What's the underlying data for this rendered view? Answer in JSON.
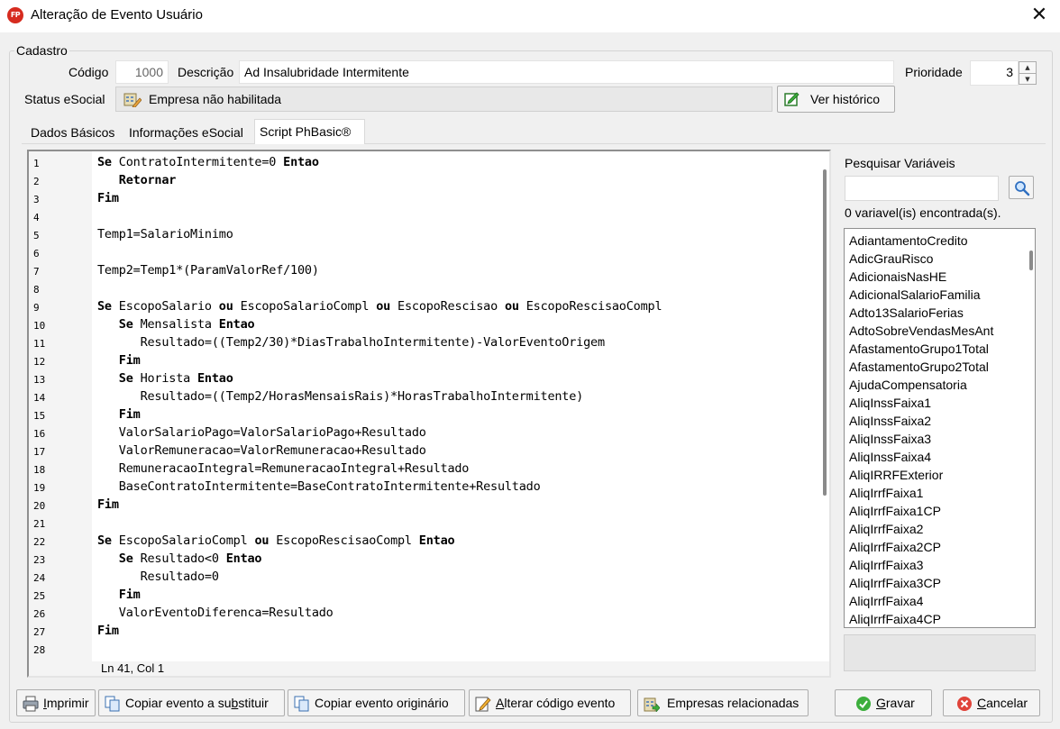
{
  "window": {
    "title": "Alteração de Evento Usuário",
    "logo_text": "FP",
    "close_glyph": "✕"
  },
  "cadastro": {
    "legend": "Cadastro",
    "codigo_label": "Código",
    "codigo_value": "1000",
    "descricao_label": "Descrição",
    "descricao_value": "Ad Insalubridade Intermitente",
    "prioridade_label": "Prioridade",
    "prioridade_value": "3",
    "status_label": "Status eSocial",
    "status_value": "Empresa não habilitada",
    "historico_button": "Ver histórico"
  },
  "tabs": [
    {
      "label": "Dados Básicos"
    },
    {
      "label": "Informações eSocial"
    },
    {
      "label": "Script PhBasic®"
    }
  ],
  "editor": {
    "lines": [
      [
        {
          "t": "Se ",
          "k": 1
        },
        {
          "t": "ContratoIntermitente=0 "
        },
        {
          "t": "Entao",
          "k": 1
        }
      ],
      [
        {
          "t": "   Retornar",
          "k": 1
        }
      ],
      [
        {
          "t": "Fim",
          "k": 1
        }
      ],
      [],
      [
        {
          "t": "Temp1=SalarioMinimo"
        }
      ],
      [],
      [
        {
          "t": "Temp2=Temp1*(ParamValorRef/100)"
        }
      ],
      [],
      [
        {
          "t": "Se ",
          "k": 1
        },
        {
          "t": "EscopoSalario "
        },
        {
          "t": "ou ",
          "k": 1
        },
        {
          "t": "EscopoSalarioCompl "
        },
        {
          "t": "ou ",
          "k": 1
        },
        {
          "t": "EscopoRescisao "
        },
        {
          "t": "ou ",
          "k": 1
        },
        {
          "t": "EscopoRescisaoCompl"
        }
      ],
      [
        {
          "t": "   Se ",
          "k": 1
        },
        {
          "t": "Mensalista "
        },
        {
          "t": "Entao",
          "k": 1
        }
      ],
      [
        {
          "t": "      Resultado=((Temp2/30)*DiasTrabalhoIntermitente)-ValorEventoOrigem"
        }
      ],
      [
        {
          "t": "   Fim",
          "k": 1
        }
      ],
      [
        {
          "t": "   Se ",
          "k": 1
        },
        {
          "t": "Horista "
        },
        {
          "t": "Entao",
          "k": 1
        }
      ],
      [
        {
          "t": "      Resultado=((Temp2/HorasMensaisRais)*HorasTrabalhoIntermitente)"
        }
      ],
      [
        {
          "t": "   Fim",
          "k": 1
        }
      ],
      [
        {
          "t": "   ValorSalarioPago=ValorSalarioPago+Resultado"
        }
      ],
      [
        {
          "t": "   ValorRemuneracao=ValorRemuneracao+Resultado"
        }
      ],
      [
        {
          "t": "   RemuneracaoIntegral=RemuneracaoIntegral+Resultado"
        }
      ],
      [
        {
          "t": "   BaseContratoIntermitente=BaseContratoIntermitente+Resultado"
        }
      ],
      [
        {
          "t": "Fim",
          "k": 1
        }
      ],
      [],
      [
        {
          "t": "Se ",
          "k": 1
        },
        {
          "t": "EscopoSalarioCompl "
        },
        {
          "t": "ou ",
          "k": 1
        },
        {
          "t": "EscopoRescisaoCompl "
        },
        {
          "t": "Entao",
          "k": 1
        }
      ],
      [
        {
          "t": "   Se ",
          "k": 1
        },
        {
          "t": "Resultado<0 "
        },
        {
          "t": "Entao",
          "k": 1
        }
      ],
      [
        {
          "t": "      Resultado=0"
        }
      ],
      [
        {
          "t": "   Fim",
          "k": 1
        }
      ],
      [
        {
          "t": "   ValorEventoDiferenca=Resultado"
        }
      ],
      [
        {
          "t": "Fim",
          "k": 1
        }
      ],
      []
    ],
    "status": "Ln 41, Col 1"
  },
  "variables": {
    "search_label": "Pesquisar Variáveis",
    "search_value": "",
    "found_text": "0 variavel(is) encontrada(s).",
    "items": [
      "AdiantamentoCredito",
      "AdicGrauRisco",
      "AdicionaisNasHE",
      "AdicionalSalarioFamilia",
      "Adto13SalarioFerias",
      "AdtoSobreVendasMesAnt",
      "AfastamentoGrupo1Total",
      "AfastamentoGrupo2Total",
      "AjudaCompensatoria",
      "AliqInssFaixa1",
      "AliqInssFaixa2",
      "AliqInssFaixa3",
      "AliqInssFaixa4",
      "AliqIRRFExterior",
      "AliqIrrfFaixa1",
      "AliqIrrfFaixa1CP",
      "AliqIrrfFaixa2",
      "AliqIrrfFaixa2CP",
      "AliqIrrfFaixa3",
      "AliqIrrfFaixa3CP",
      "AliqIrrfFaixa4",
      "AliqIrrfFaixa4CP"
    ]
  },
  "footer": {
    "imprimir": {
      "pre": "",
      "u": "I",
      "post": "mprimir"
    },
    "copiar_substituir": {
      "pre": "Copiar evento a su",
      "u": "b",
      "post": "stituir"
    },
    "copiar_originario": "Copiar evento originário",
    "alterar_codigo": {
      "pre": "",
      "u": "A",
      "post": "lterar código evento"
    },
    "empresas": "Empresas relacionadas",
    "gravar": {
      "pre": "",
      "u": "G",
      "post": "ravar"
    },
    "cancelar": {
      "pre": "",
      "u": "C",
      "post": "ancelar"
    }
  },
  "colors": {
    "keyword": "#000000",
    "close_icon": "#111111",
    "logo": "#d62b1f",
    "gravar_icon": "#3cae3c",
    "cancelar_icon": "#e0443a"
  }
}
